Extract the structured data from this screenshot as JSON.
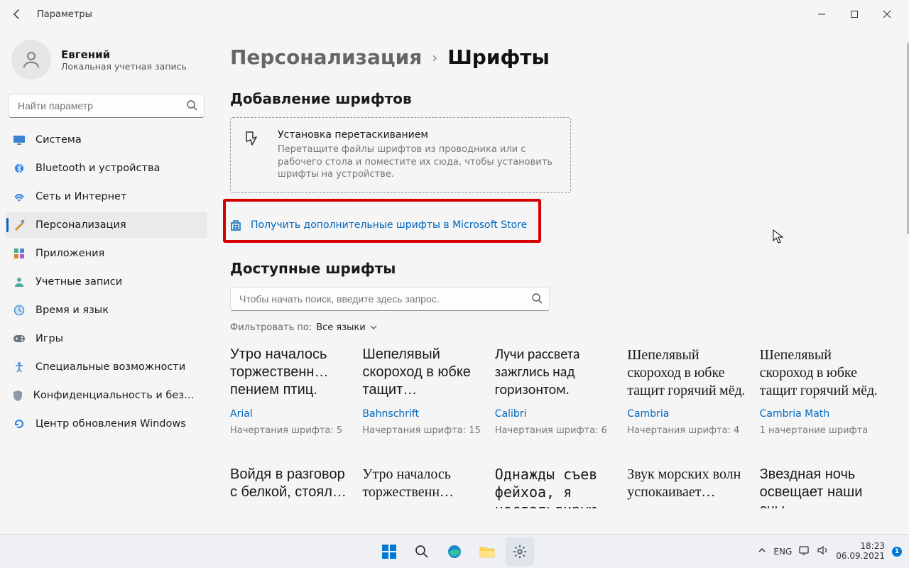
{
  "window": {
    "title": "Параметры"
  },
  "user": {
    "name": "Евгений",
    "subtitle": "Локальная учетная запись"
  },
  "search": {
    "placeholder": "Найти параметр"
  },
  "nav": {
    "items": [
      {
        "label": "Система",
        "icon": "system"
      },
      {
        "label": "Bluetooth и устройства",
        "icon": "bluetooth"
      },
      {
        "label": "Сеть и Интернет",
        "icon": "network"
      },
      {
        "label": "Персонализация",
        "icon": "personalization",
        "active": true
      },
      {
        "label": "Приложения",
        "icon": "apps"
      },
      {
        "label": "Учетные записи",
        "icon": "accounts"
      },
      {
        "label": "Время и язык",
        "icon": "time"
      },
      {
        "label": "Игры",
        "icon": "gaming"
      },
      {
        "label": "Специальные возможности",
        "icon": "accessibility"
      },
      {
        "label": "Конфиденциальность и безопасность",
        "icon": "privacy"
      },
      {
        "label": "Центр обновления Windows",
        "icon": "update"
      }
    ]
  },
  "breadcrumb": {
    "parent": "Персонализация",
    "current": "Шрифты"
  },
  "sections": {
    "add": "Добавление шрифтов",
    "available": "Доступные шрифты"
  },
  "dropzone": {
    "title": "Установка перетаскиванием",
    "subtitle": "Перетащите файлы шрифтов из проводника или с рабочего стола и поместите их сюда, чтобы установить шрифты на устройстве."
  },
  "storelink": {
    "label": "Получить дополнительные шрифты в Microsoft Store"
  },
  "fontsearch": {
    "placeholder": "Чтобы начать поиск, введите здесь запрос."
  },
  "filter": {
    "label": "Фильтровать по:",
    "value": "Все языки"
  },
  "fonts_row1": [
    {
      "sample": "Утро началось торжественн… пением птиц.",
      "name": "Arial",
      "meta": "Начертания шрифта: 5",
      "family": "Arial, sans-serif"
    },
    {
      "sample": "Шепелявый скороход в юбке тащит…",
      "name": "Bahnschrift",
      "meta": "Начертания шрифта: 15",
      "family": "Bahnschrift, sans-serif"
    },
    {
      "sample": "Лучи рассвета зажглись над горизонтом.",
      "name": "Calibri",
      "meta": "Начертания шрифта: 6",
      "family": "Calibri, sans-serif"
    },
    {
      "sample": "Шепелявый скороход в юбке тащит горячий мёд.",
      "name": "Cambria",
      "meta": "Начертания шрифта: 4",
      "family": "Cambria, serif"
    },
    {
      "sample": "Шепелявый скороход в юбке тащит горячий мёд.",
      "name": "Cambria Math",
      "meta": "1 начертание шрифта",
      "family": "'Cambria Math', Cambria, serif"
    }
  ],
  "fonts_row2": [
    {
      "sample": "Войдя в разговор с белкой, стоял…",
      "family": "Candara, sans-serif"
    },
    {
      "sample": "Утро началось торжественн…",
      "family": "'Comic Sans MS', cursive"
    },
    {
      "sample": "Однажды съев фейхоа, я ностальгирую",
      "family": "Consolas, monospace"
    },
    {
      "sample": "Звук морских волн успокаивает…",
      "family": "Constantia, serif"
    },
    {
      "sample": "Звездная ночь освещает наши сны.",
      "family": "Corbel, sans-serif"
    }
  ],
  "taskbar": {
    "lang": "ENG",
    "time": "18:23",
    "date": "06.09.2021"
  }
}
